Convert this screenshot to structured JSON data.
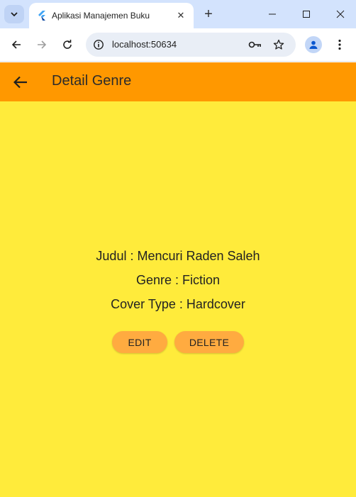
{
  "browser": {
    "tab_title": "Aplikasi Manajemen Buku",
    "url": "localhost:50634"
  },
  "app": {
    "title": "Detail Genre",
    "fields": [
      {
        "text": "Judul : Mencuri Raden Saleh"
      },
      {
        "text": "Genre : Fiction"
      },
      {
        "text": "Cover Type : Hardcover"
      }
    ],
    "edit_label": "EDIT",
    "delete_label": "DELETE"
  },
  "colors": {
    "appbar": "#ff9800",
    "background": "#ffeb3b",
    "button": "#ffab40"
  }
}
